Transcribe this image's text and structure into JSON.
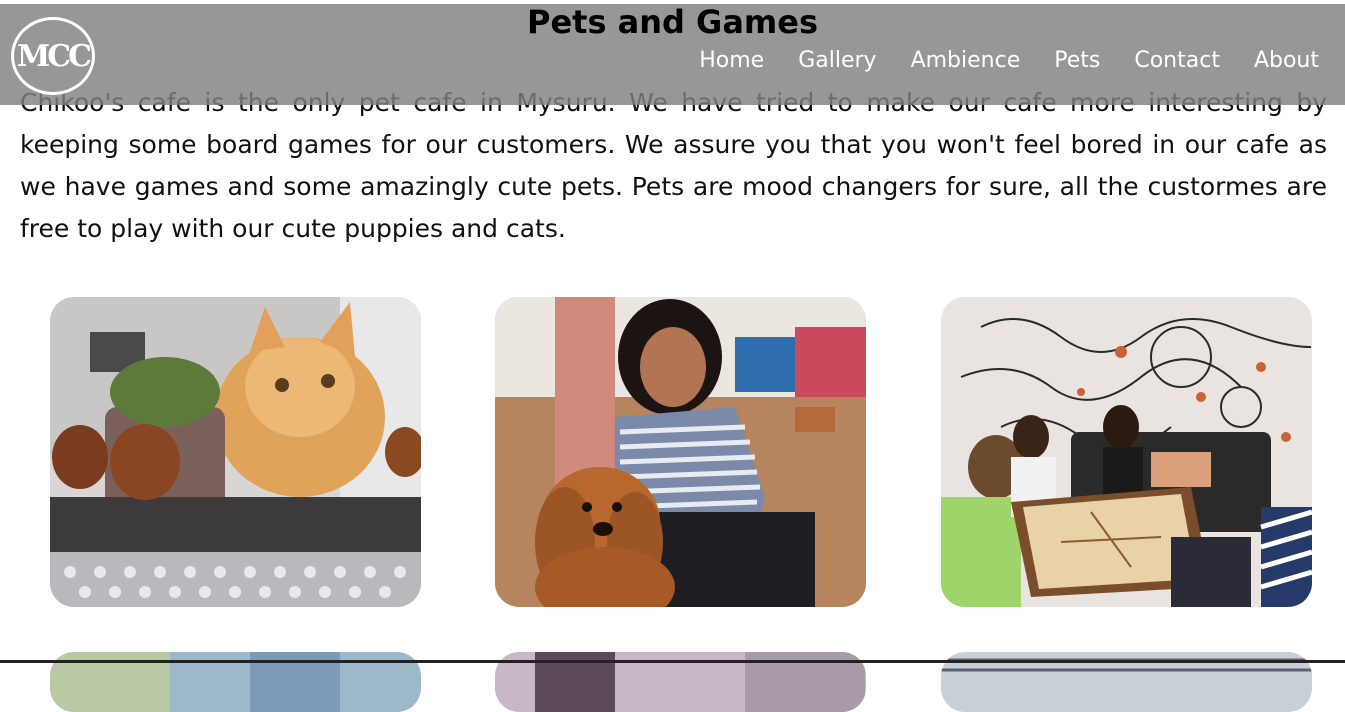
{
  "header": {
    "logo_text": "MCC",
    "title": "Pets and Games",
    "nav": [
      {
        "label": "Home"
      },
      {
        "label": "Gallery"
      },
      {
        "label": "Ambience"
      },
      {
        "label": "Pets"
      },
      {
        "label": "Contact"
      },
      {
        "label": "About"
      }
    ]
  },
  "intro": {
    "text": "Chikoo's cafe is the only pet cafe in Mysuru. We have tried to make our cafe more interesting by keeping some board games for our customers. We assure you that you won't feel bored in our cafe as we have games and some amazingly cute pets. Pets are mood changers for sure, all the custormes are free to play with our cute puppies and cats."
  },
  "colors": {
    "header_bg": "#808080",
    "nav_text": "#ffffff",
    "body_text": "#111111"
  }
}
